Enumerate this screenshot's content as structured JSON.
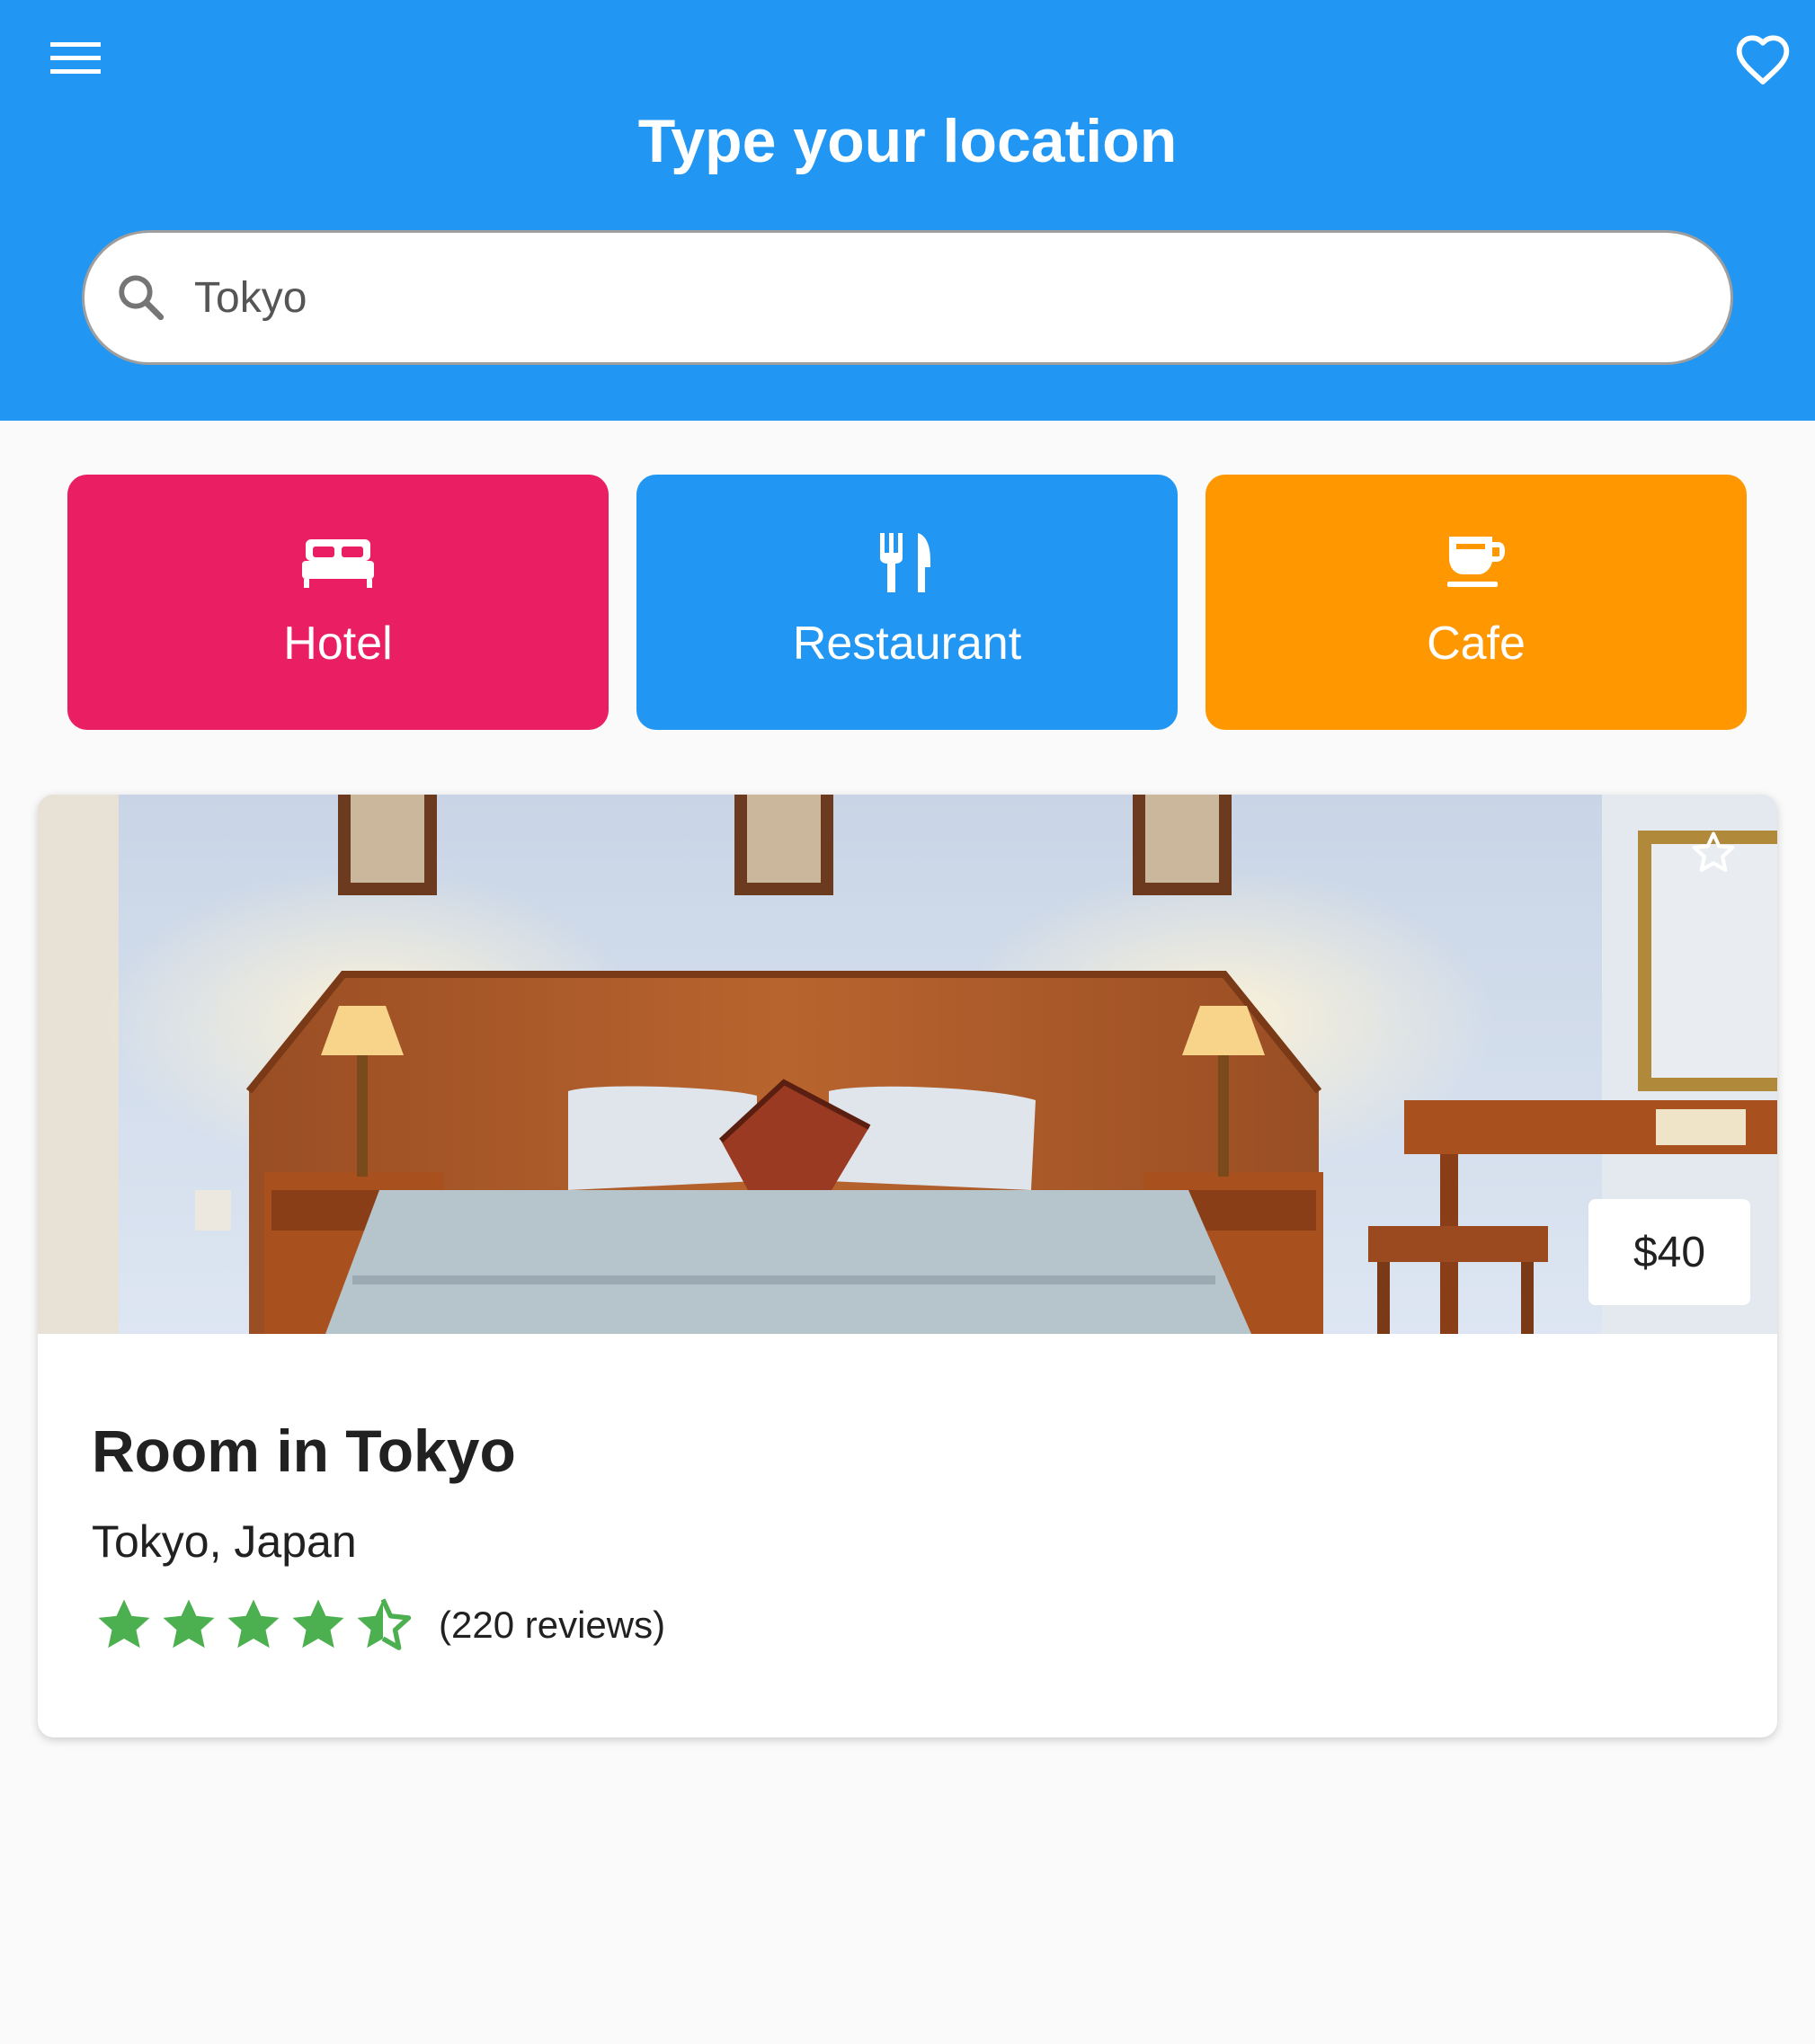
{
  "header": {
    "title": "Type your location",
    "menu_icon": "menu-icon",
    "favorite_icon": "heart-outline-icon",
    "background_color": "#2196f3"
  },
  "search": {
    "value": "Tokyo",
    "icon": "search-icon"
  },
  "categories": [
    {
      "label": "Hotel",
      "icon": "bed-icon",
      "color": "#e91e63"
    },
    {
      "label": "Restaurant",
      "icon": "fork-knife-icon",
      "color": "#2196f3"
    },
    {
      "label": "Cafe",
      "icon": "coffee-cup-icon",
      "color": "#ff9800"
    }
  ],
  "listing": {
    "title": "Room in Tokyo",
    "location": "Tokyo, Japan",
    "price": "$40",
    "rating": 4.5,
    "reviews": "(220 reviews)",
    "bookmark_icon": "star-outline-icon",
    "star_color": "#4caf50"
  }
}
